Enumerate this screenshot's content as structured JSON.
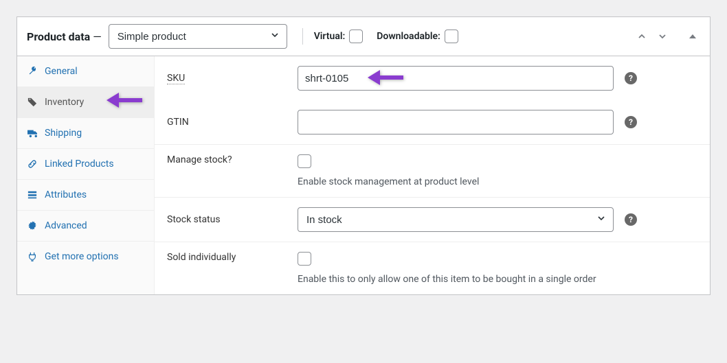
{
  "header": {
    "title": "Product data",
    "dash": " — ",
    "product_type": "Simple product",
    "virtual_label": "Virtual:",
    "downloadable_label": "Downloadable:"
  },
  "tabs": {
    "general": "General",
    "inventory": "Inventory",
    "shipping": "Shipping",
    "linked": "Linked Products",
    "attributes": "Attributes",
    "advanced": "Advanced",
    "get_more": "Get more options"
  },
  "fields": {
    "sku": {
      "label": "SKU",
      "value": "shrt-0105"
    },
    "gtin": {
      "label": "GTIN",
      "value": ""
    },
    "manage_stock": {
      "label": "Manage stock?",
      "hint": "Enable stock management at product level"
    },
    "stock_status": {
      "label": "Stock status",
      "value": "In stock"
    },
    "sold_individually": {
      "label": "Sold individually",
      "hint": "Enable this to only allow one of this item to be bought in a single order"
    }
  }
}
